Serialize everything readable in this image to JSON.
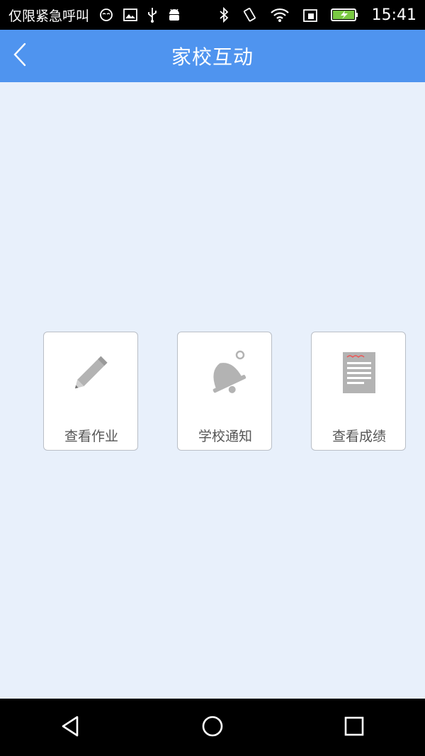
{
  "status_bar": {
    "carrier": "仅限紧急呼叫",
    "time": "15:41",
    "icons_left": [
      "mask-icon",
      "image-icon",
      "usb-icon",
      "android-icon"
    ],
    "icons_right": [
      "bluetooth-icon",
      "vibrate-icon",
      "wifi-icon",
      "sim-icon",
      "battery-charging-icon"
    ]
  },
  "header": {
    "title": "家校互动",
    "back_icon": "chevron-left-icon"
  },
  "tiles": [
    {
      "label": "查看作业",
      "icon": "pencil-icon"
    },
    {
      "label": "学校通知",
      "icon": "bell-icon"
    },
    {
      "label": "查看成绩",
      "icon": "report-icon"
    }
  ],
  "nav_bar": {
    "buttons": [
      "back-triangle-icon",
      "home-circle-icon",
      "recents-square-icon"
    ]
  },
  "colors": {
    "header_bg": "#4f94ef",
    "page_bg": "#e8f0fb",
    "tile_label": "#555555",
    "icon_gray": "#b3b3b3"
  }
}
